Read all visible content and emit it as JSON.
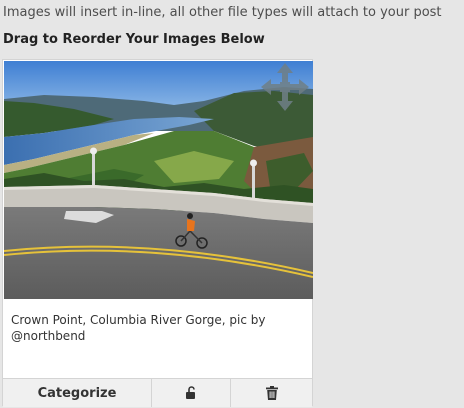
{
  "upload_notice": "Images will insert in-line, all other file types will attach to your post",
  "reorder_heading": "Drag to Reorder Your Images Below",
  "image_card": {
    "caption": "Crown Point, Columbia River Gorge, pic by @northbend",
    "drag_icon": "move-arrows-icon",
    "actions": {
      "categorize_label": "Categorize",
      "lock_icon": "unlock-icon",
      "delete_icon": "trash-icon"
    }
  },
  "colors": {
    "page_background": "#e6e6e6",
    "toolbar_background": "#f0f0f0",
    "border": "#d4d4d4"
  }
}
